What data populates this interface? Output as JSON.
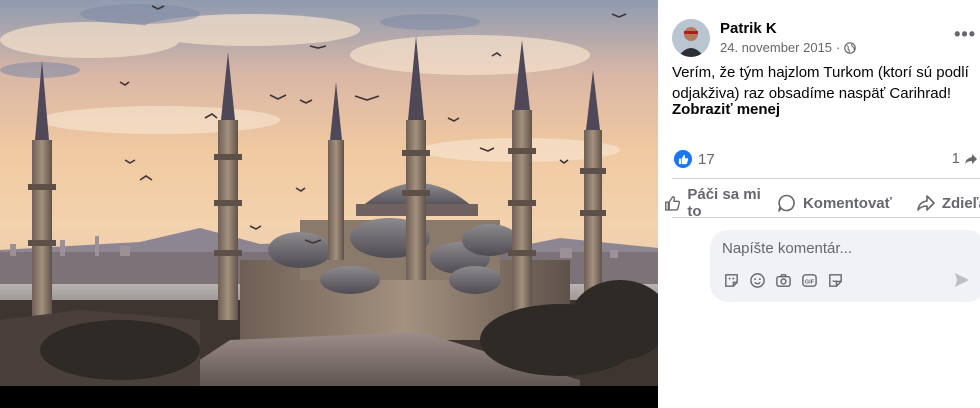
{
  "post": {
    "author": "Patrik K",
    "date": "24. november 2015",
    "separator": "·",
    "privacy_icon": "globe-icon",
    "text": "Verím, že tým hajzlom Turkom (ktorí sú podlí odjakživa) raz obsadíme naspäť Carihrad!",
    "see_less": "Zobraziť menej",
    "more_icon": "more-options-icon"
  },
  "reactions": {
    "count": "17",
    "shares": "1"
  },
  "actions": {
    "like": "Páči sa mi to",
    "comment": "Komentovať",
    "share": "Zdieľať"
  },
  "comment_box": {
    "placeholder": "Napíšte komentár...",
    "icons": [
      "avatar-sticker-icon",
      "emoji-icon",
      "camera-icon",
      "gif-icon",
      "sticker-icon"
    ],
    "send_icon": "send-icon"
  },
  "colors": {
    "accent": "#1877f2",
    "text": "#050505",
    "muted": "#65676b",
    "comment_bg": "#f0f2f5"
  }
}
